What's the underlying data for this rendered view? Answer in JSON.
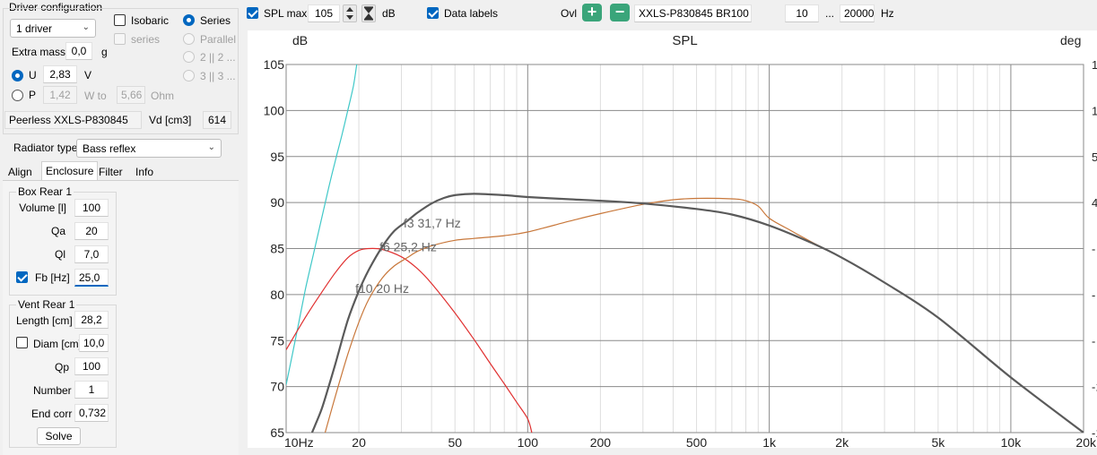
{
  "driver_config": {
    "title": "Driver configuration",
    "driver_count": "1 driver",
    "isobaric": "Isobaric",
    "series_option": "series",
    "series_radio": "Series",
    "parallel": "Parallel",
    "opt2": "2 || 2 ...",
    "opt3": "3 || 3 ...",
    "extra_mass_label": "Extra mass",
    "extra_mass_value": "0,0",
    "extra_mass_unit": "g",
    "u_label": "U",
    "u_value": "2,83",
    "u_unit": "V",
    "p_label": "P",
    "p_value": "1,42",
    "w_to_label": "W to",
    "w_to_value": "5,66",
    "ohm_label": "Ohm",
    "driver_name": "Peerless XXLS-P830845",
    "vd_label": "Vd [cm3]",
    "vd_value": "614"
  },
  "radiator": {
    "label": "Radiator type",
    "value": "Bass reflex"
  },
  "tabs": [
    "Align",
    "Enclosure",
    "Filter",
    "Info"
  ],
  "box": {
    "title": "Box Rear 1",
    "volume_label": "Volume [l]",
    "volume": "100",
    "qa_label": "Qa",
    "qa": "20",
    "ql_label": "Ql",
    "ql": "7,0",
    "fb_label": "Fb [Hz]",
    "fb": "25,0"
  },
  "vent": {
    "title": "Vent Rear 1",
    "length_label": "Length [cm]",
    "length": "28,2",
    "diam_label": "Diam [cm]",
    "diam": "10,0",
    "qp_label": "Qp",
    "qp": "100",
    "number_label": "Number",
    "number": "1",
    "endcorr_label": "End corr",
    "endcorr": "0,732",
    "solve": "Solve"
  },
  "toolbar": {
    "spl_max_label": "SPL max",
    "spl_max_value": "105",
    "db_unit": "dB",
    "data_labels": "Data labels",
    "ovl_label": "Ovl",
    "ovl_name": "XXLS-P830845 BR100",
    "f_min": "10",
    "ellipsis": "...",
    "f_max": "20000",
    "hz_unit": "Hz"
  },
  "chart_data": {
    "type": "line",
    "title": "SPL",
    "ylabel": "dB",
    "y2label": "deg",
    "xscale": "log",
    "xlim": [
      10,
      20000
    ],
    "ylim": [
      65,
      105
    ],
    "xticks": [
      {
        "v": 10,
        "t": "10Hz"
      },
      {
        "v": 20,
        "t": "20"
      },
      {
        "v": 50,
        "t": "50"
      },
      {
        "v": 100,
        "t": "100"
      },
      {
        "v": 200,
        "t": "200"
      },
      {
        "v": 500,
        "t": "500"
      },
      {
        "v": 1000,
        "t": "1k"
      },
      {
        "v": 2000,
        "t": "2k"
      },
      {
        "v": 5000,
        "t": "5k"
      },
      {
        "v": 10000,
        "t": "10k"
      },
      {
        "v": 20000,
        "t": "20k"
      }
    ],
    "yticks": [
      105,
      100,
      95,
      90,
      85,
      80,
      75,
      70,
      65
    ],
    "right_ticks": [
      "1",
      "1",
      "5",
      "4",
      "-",
      "-",
      "-",
      "-1",
      "-1"
    ],
    "grid": true,
    "series": [
      {
        "color": "#5a5a5a",
        "width": 2.2,
        "x": [
          12.8,
          14,
          15,
          16,
          18,
          20,
          22,
          25,
          28,
          31.7,
          35,
          40,
          45,
          50,
          60,
          80,
          100,
          150,
          200,
          300,
          500,
          700,
          1000,
          1500,
          2000,
          3000,
          5000,
          10000,
          20000
        ],
        "y": [
          65,
          67.5,
          70,
          72.5,
          77.2,
          80.4,
          82.7,
          85.2,
          86.9,
          88,
          88.9,
          89.9,
          90.5,
          90.8,
          90.95,
          90.8,
          90.6,
          90.35,
          90.2,
          89.9,
          89.3,
          88.7,
          87.5,
          85.6,
          84,
          81.3,
          77.5,
          71,
          65
        ]
      },
      {
        "color": "#c8773a",
        "width": 1.2,
        "x": [
          14.5,
          16,
          18,
          20,
          22,
          25,
          28,
          31.7,
          35,
          40,
          50,
          60,
          80,
          100,
          150,
          200,
          300,
          400,
          500,
          700,
          800,
          900,
          1000,
          1200,
          1500,
          2000,
          3000,
          5000,
          10000,
          20000
        ],
        "y": [
          65,
          69,
          73.5,
          77,
          79.5,
          81.8,
          83.1,
          84,
          84.7,
          85.3,
          85.9,
          86.1,
          86.4,
          86.8,
          88,
          88.8,
          89.8,
          90.3,
          90.45,
          90.4,
          90.2,
          89.6,
          88.3,
          87.1,
          85.7,
          84,
          81.3,
          77.5,
          71,
          65
        ]
      },
      {
        "color": "#e03030",
        "width": 1.2,
        "x": [
          10,
          12,
          14,
          16,
          18,
          20,
          22,
          25,
          30,
          35,
          40,
          50,
          60,
          70,
          80,
          90,
          100,
          104
        ],
        "y": [
          74,
          77.5,
          80.2,
          82.4,
          84,
          84.8,
          85,
          84.9,
          84.1,
          82.8,
          81.2,
          78,
          75.1,
          72.5,
          70.3,
          68.3,
          66.5,
          65
        ]
      },
      {
        "color": "#40c8c8",
        "width": 1.2,
        "x": [
          10,
          11,
          12,
          13,
          14,
          15,
          16,
          17,
          18,
          19,
          19.6
        ],
        "y": [
          70.2,
          75.5,
          80.5,
          84.5,
          88.2,
          91.6,
          94.6,
          97.3,
          100,
          102.7,
          105
        ]
      }
    ],
    "annotations": [
      {
        "x": 31.7,
        "y": 87.3,
        "text": "f3 31,7 Hz"
      },
      {
        "x": 25.2,
        "y": 84.7,
        "text": "f6 25,2 Hz"
      },
      {
        "x": 20,
        "y": 80.2,
        "text": "f10 20 Hz"
      }
    ]
  }
}
